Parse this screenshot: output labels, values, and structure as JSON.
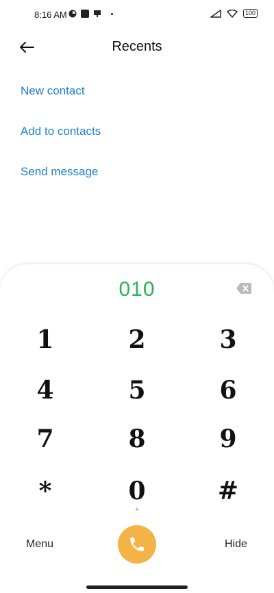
{
  "status": {
    "time": "8:16 AM",
    "battery": "100"
  },
  "header": {
    "title": "Recents"
  },
  "actions": [
    {
      "label": "New contact"
    },
    {
      "label": "Add to contacts"
    },
    {
      "label": "Send message"
    }
  ],
  "dialer": {
    "number": "010",
    "keys": [
      {
        "digit": "1",
        "sub": ""
      },
      {
        "digit": "2",
        "sub": ""
      },
      {
        "digit": "3",
        "sub": ""
      },
      {
        "digit": "4",
        "sub": ""
      },
      {
        "digit": "5",
        "sub": ""
      },
      {
        "digit": "6",
        "sub": ""
      },
      {
        "digit": "7",
        "sub": ""
      },
      {
        "digit": "8",
        "sub": ""
      },
      {
        "digit": "9",
        "sub": ""
      },
      {
        "digit": "*",
        "sub": ""
      },
      {
        "digit": "0",
        "sub": "+"
      },
      {
        "digit": "#",
        "sub": ""
      }
    ],
    "menu_label": "Menu",
    "hide_label": "Hide"
  },
  "colors": {
    "accent_blue": "#1c7fd6",
    "number_green": "#27b35a",
    "call_orange": "#f4b346"
  },
  "icons": {
    "back": "arrow-left-icon",
    "backspace": "backspace-icon",
    "call": "phone-icon"
  }
}
